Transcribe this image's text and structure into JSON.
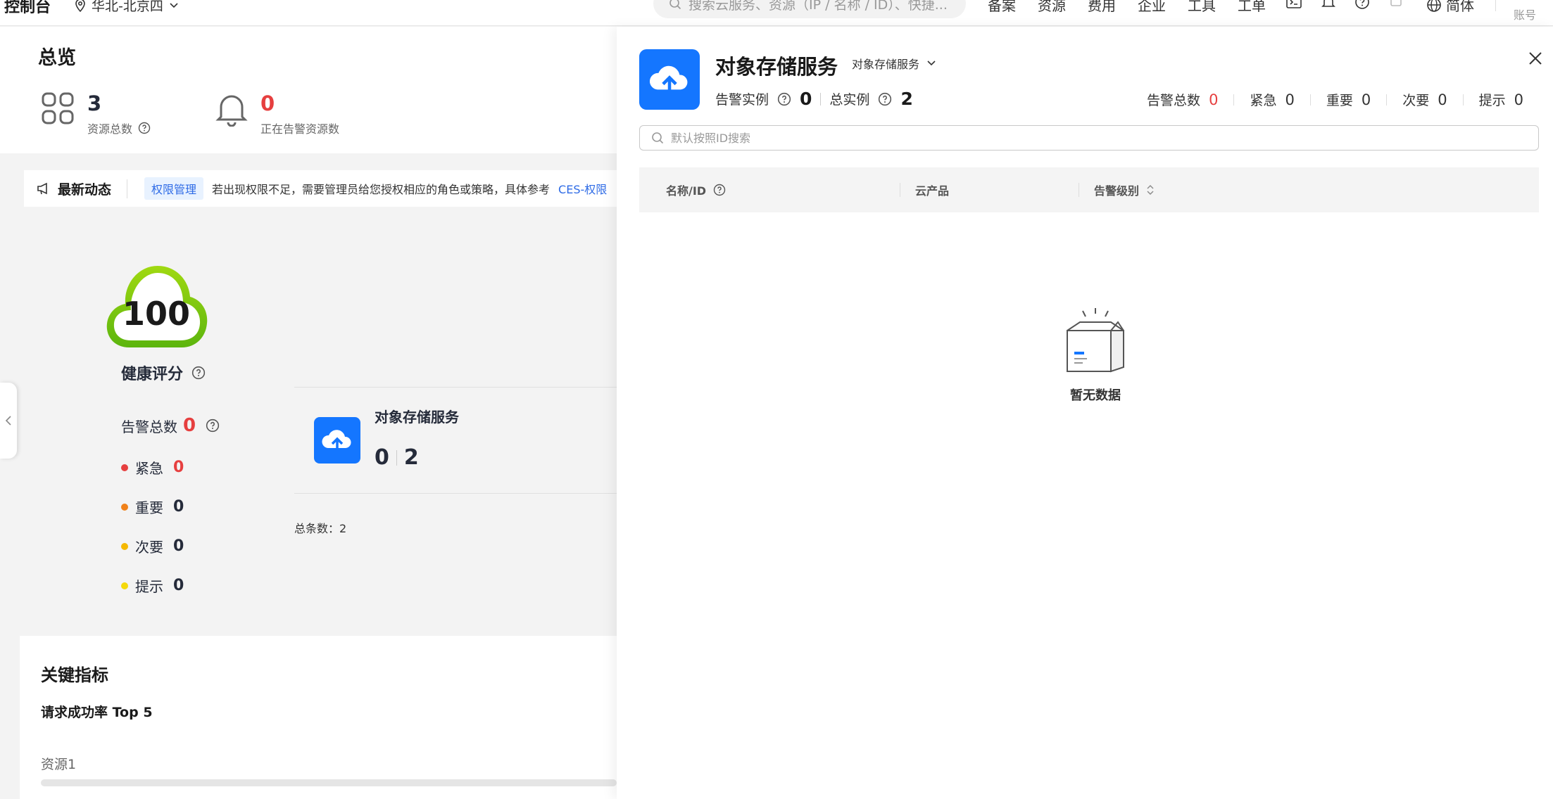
{
  "topnav": {
    "logo": "控制台",
    "region": "华北-北京四",
    "search_placeholder": "搜索云服务、资源（IP / 名称 / ID）、快捷...",
    "items": [
      "备案",
      "资源",
      "费用",
      "企业",
      "工具",
      "工单"
    ],
    "language": "简体",
    "account": "账号"
  },
  "overview": {
    "title": "总览",
    "resource_total": {
      "value": "3",
      "label": "资源总数"
    },
    "alarming_resources": {
      "value": "0",
      "label": "正在告警资源数"
    }
  },
  "news": {
    "title": "最新动态",
    "tag": "权限管理",
    "message": "若出现权限不足，需要管理员给您授权相应的角色或策略，具体参考",
    "link": "CES-权限"
  },
  "health": {
    "score": "100",
    "label": "健康评分",
    "alarm_total_label": "告警总数",
    "alarm_total": "0",
    "levels": [
      {
        "label": "紧急",
        "value": "0",
        "color": "#e63f3f"
      },
      {
        "label": "重要",
        "value": "0",
        "color": "#f0811a"
      },
      {
        "label": "次要",
        "value": "0",
        "color": "#f5b800"
      },
      {
        "label": "提示",
        "value": "0",
        "color": "#f5d90a"
      }
    ]
  },
  "service_card": {
    "name": "对象存储服务",
    "alarm_count": "0",
    "total_count": "2"
  },
  "total_items": "总条数：2",
  "metrics": {
    "title": "关键指标",
    "subtitle": "请求成功率 Top 5",
    "resource": "资源1",
    "progress": 0
  },
  "drawer": {
    "title": "对象存储服务",
    "service_select": "对象存储服务",
    "alarm_instances_label": "告警实例",
    "alarm_instances": "0",
    "total_instances_label": "总实例",
    "total_instances": "2",
    "alarms": [
      {
        "label": "告警总数",
        "value": "0",
        "color": "#e63f3f"
      },
      {
        "label": "紧急",
        "value": "0",
        "color": "#252b3a"
      },
      {
        "label": "重要",
        "value": "0",
        "color": "#252b3a"
      },
      {
        "label": "次要",
        "value": "0",
        "color": "#252b3a"
      },
      {
        "label": "提示",
        "value": "0",
        "color": "#252b3a"
      }
    ],
    "search_placeholder": "默认按照ID搜索",
    "columns": [
      "名称/ID",
      "云产品",
      "告警级别"
    ],
    "empty_text": "暂无数据"
  },
  "colors": {
    "accent": "#1476ff",
    "health_green": "#7cc61a",
    "alert_red": "#e63f3f"
  }
}
